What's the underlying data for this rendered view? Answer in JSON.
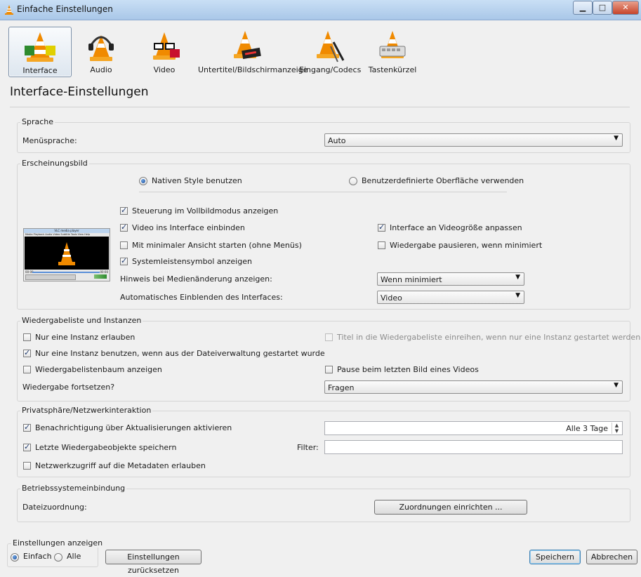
{
  "window": {
    "title": "Einfache Einstellungen",
    "min": "▁",
    "max": "□",
    "close": "✕"
  },
  "tabs": [
    {
      "label": "Interface",
      "icon": "cone-interface-icon"
    },
    {
      "label": "Audio",
      "icon": "cone-headphones-icon"
    },
    {
      "label": "Video",
      "icon": "cone-glasses-icon"
    },
    {
      "label": "Untertitel/Bildschirmanzeige",
      "icon": "cone-subtitle-icon"
    },
    {
      "label": "Eingang/Codecs",
      "icon": "cone-cables-icon"
    },
    {
      "label": "Tastenkürzel",
      "icon": "cone-keyboard-icon"
    }
  ],
  "heading": "Interface-Einstellungen",
  "sprache": {
    "title": "Sprache",
    "menu_label": "Menüsprache:",
    "menu_value": "Auto"
  },
  "erscheinung": {
    "title": "Erscheinungsbild",
    "native_style": "Nativen Style benutzen",
    "custom_skin": "Benutzerdefinierte Oberfläche verwenden",
    "fullscreen_controls": "Steuerung im Vollbildmodus anzeigen",
    "embed_video": "Video ins Interface einbinden",
    "resize_interface": "Interface an Videogröße anpassen",
    "minimal_view": "Mit minimaler Ansicht starten (ohne Menüs)",
    "pause_minimized": "Wiedergabe pausieren, wenn minimiert",
    "systray": "Systemleistensymbol anzeigen",
    "media_change_label": "Hinweis bei Medienänderung anzeigen:",
    "media_change_value": "Wenn minimiert",
    "auto_raise_label": "Automatisches Einblenden des Interfaces:",
    "auto_raise_value": "Video"
  },
  "playlist": {
    "title": "Wiedergabeliste und Instanzen",
    "one_instance": "Nur eine Instanz erlauben",
    "enqueue": "Titel in die Wiedergabeliste einreihen, wenn nur eine Instanz gestartet werden darf",
    "one_instance_fm": "Nur eine Instanz benutzen, wenn aus der Dateiverwaltung gestartet wurde",
    "tree": "Wiedergabelistenbaum anzeigen",
    "pause_last": "Pause beim letzten Bild eines Videos",
    "resume_label": "Wiedergabe fortsetzen?",
    "resume_value": "Fragen"
  },
  "privacy": {
    "title": "Privatsphäre/Netzwerkinteraktion",
    "updates": "Benachrichtigung über Aktualisierungen aktivieren",
    "updates_interval": "Alle 3 Tage",
    "recent": "Letzte Wiedergabeobjekte speichern",
    "filter_label": "Filter:",
    "filter_value": "",
    "metadata": "Netzwerkzugriff auf die Metadaten erlauben"
  },
  "os": {
    "title": "Betriebssystemeinbindung",
    "assoc_label": "Dateizuordnung:",
    "assoc_button": "Zuordnungen einrichten ..."
  },
  "footer": {
    "show_title": "Einstellungen anzeigen",
    "simple": "Einfach",
    "all": "Alle",
    "reset": "Einstellungen zurücksetzen",
    "save": "Speichern",
    "cancel": "Abbrechen"
  },
  "preview": {
    "title": "VLC media player",
    "menu": "Media  Playback  Audio  Video  Subtitle  Tools  View  Help",
    "time_left": "00:00",
    "time_right": "00:00"
  }
}
